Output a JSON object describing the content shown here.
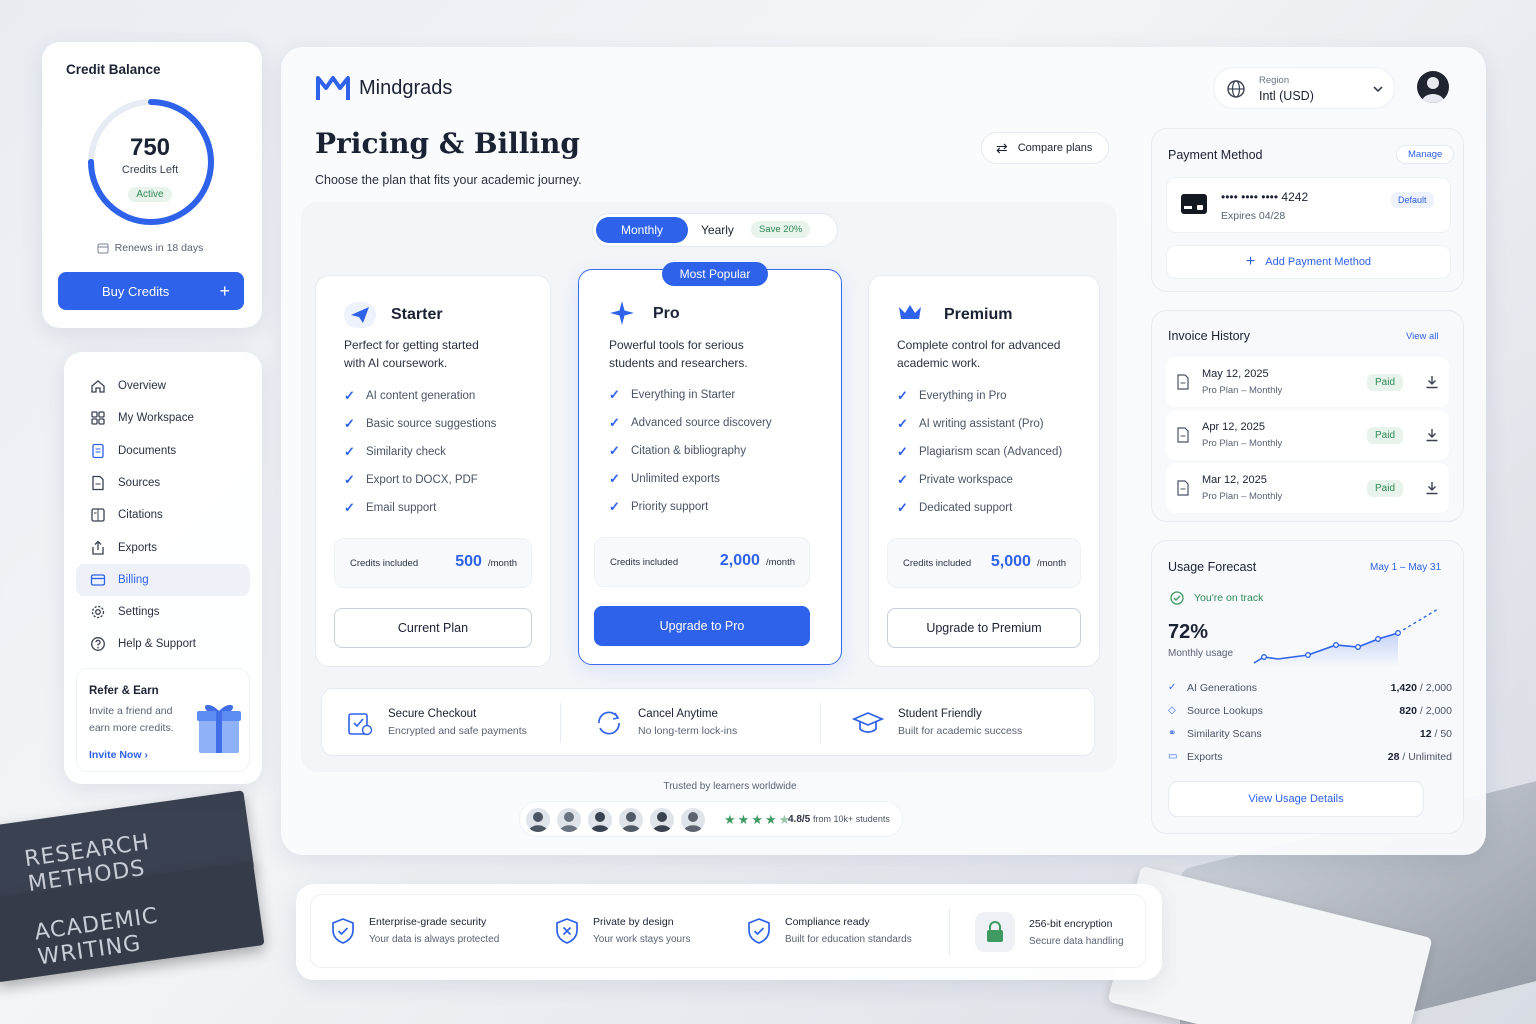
{
  "colors": {
    "accent": "#2f62ea",
    "success": "#2f8a55",
    "background": "#f3f5f8"
  },
  "credit": {
    "title": "Credit Balance",
    "amount": "750",
    "label": "Credits Left",
    "status": "Active",
    "renews": "Renews in 18 days",
    "progress": 0.75,
    "buy_label": "Buy Credits"
  },
  "nav": {
    "items": [
      {
        "label": "Overview",
        "icon": "home-icon"
      },
      {
        "label": "My Workspace",
        "icon": "workspace-icon"
      },
      {
        "label": "Documents",
        "icon": "document-icon"
      },
      {
        "label": "Sources",
        "icon": "file-icon"
      },
      {
        "label": "Citations",
        "icon": "citation-icon"
      },
      {
        "label": "Exports",
        "icon": "export-icon"
      },
      {
        "label": "Billing",
        "icon": "billing-icon",
        "active": true
      },
      {
        "label": "Settings",
        "icon": "gear-icon"
      },
      {
        "label": "Help & Support",
        "icon": "help-icon"
      }
    ]
  },
  "refer": {
    "title": "Refer & Earn",
    "text1": "Invite a friend and",
    "text2": "earn more credits.",
    "link": "Invite Now"
  },
  "header": {
    "brand": "Mindgrads",
    "region_label": "Region",
    "region_value": "Intl (USD)"
  },
  "page": {
    "title": "Pricing & Billing",
    "subtitle": "Choose the plan that fits your academic journey.",
    "compare": "Compare plans"
  },
  "billing_toggle": {
    "monthly": "Monthly",
    "yearly": "Yearly",
    "save": "Save 20%",
    "selected": "Monthly"
  },
  "plans": [
    {
      "name": "Starter",
      "desc1": "Perfect for getting started",
      "desc2": "with AI coursework.",
      "features": [
        "AI content generation",
        "Basic source suggestions",
        "Similarity check",
        "Export to DOCX, PDF",
        "Email support"
      ],
      "credits_label": "Credits included",
      "credits": "500",
      "per": "/month",
      "cta": "Current Plan"
    },
    {
      "name": "Pro",
      "badge": "Most Popular",
      "desc1": "Powerful tools for serious",
      "desc2": "students and researchers.",
      "features": [
        "Everything in Starter",
        "Advanced source discovery",
        "Citation & bibliography",
        "Unlimited exports",
        "Priority support"
      ],
      "credits_label": "Credits included",
      "credits": "2,000",
      "per": "/month",
      "cta": "Upgrade to Pro"
    },
    {
      "name": "Premium",
      "desc1": "Complete control for advanced",
      "desc2": "academic work.",
      "features": [
        "Everything in Pro",
        "AI writing assistant (Pro)",
        "Plagiarism scan (Advanced)",
        "Private workspace",
        "Dedicated support"
      ],
      "credits_label": "Credits included",
      "credits": "5,000",
      "per": "/month",
      "cta": "Upgrade to Premium"
    }
  ],
  "assurances": [
    {
      "title": "Secure Checkout",
      "sub": "Encrypted and safe payments"
    },
    {
      "title": "Cancel Anytime",
      "sub": "No long-term lock-ins"
    },
    {
      "title": "Student Friendly",
      "sub": "Built for academic success"
    }
  ],
  "social": {
    "caption": "Trusted by learners worldwide",
    "rating": "4.8/5",
    "rating_suffix": "from 10k+ students",
    "stars": 4.5
  },
  "payment": {
    "title": "Payment Method",
    "manage": "Manage",
    "card": "•••• •••• •••• 4242",
    "expires": "Expires 04/28",
    "default": "Default",
    "add": "Add Payment Method"
  },
  "invoices": {
    "title": "Invoice History",
    "view_all": "View all",
    "items": [
      {
        "date": "May 12, 2025",
        "plan": "Pro Plan – Monthly",
        "status": "Paid"
      },
      {
        "date": "Apr 12, 2025",
        "plan": "Pro Plan – Monthly",
        "status": "Paid"
      },
      {
        "date": "Mar 12, 2025",
        "plan": "Pro Plan – Monthly",
        "status": "Paid"
      }
    ]
  },
  "usage": {
    "title": "Usage Forecast",
    "range": "May 1 – May 31",
    "status": "You're on track",
    "percent": "72%",
    "percent_label": "Monthly usage",
    "rows": [
      {
        "label": "AI Generations",
        "used": "1,420",
        "total": "/ 2,000"
      },
      {
        "label": "Source Lookups",
        "used": "820",
        "total": "/ 2,000"
      },
      {
        "label": "Similarity Scans",
        "used": "12",
        "total": "/ 50"
      },
      {
        "label": "Exports",
        "used": "28",
        "total": "/ Unlimited"
      }
    ],
    "details": "View Usage Details"
  },
  "footer": [
    {
      "title": "Enterprise-grade security",
      "sub": "Your data is always protected"
    },
    {
      "title": "Private by design",
      "sub": "Your work stays yours"
    },
    {
      "title": "Compliance ready",
      "sub": "Built for education standards"
    },
    {
      "title": "256-bit encryption",
      "sub": "Secure data handling"
    }
  ],
  "books": {
    "top": "RESEARCH METHODS",
    "bottom": "ACADEMIC WRITING"
  }
}
